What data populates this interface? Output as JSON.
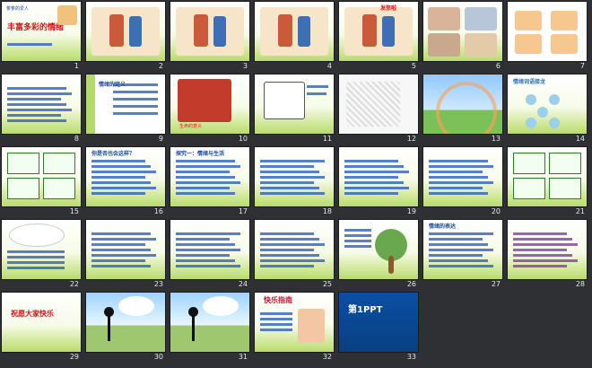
{
  "slides": [
    {
      "n": "1",
      "caption": "爹爹的爱人",
      "title": "丰富多彩的情绪",
      "kind": "title"
    },
    {
      "n": "2",
      "kind": "illustration"
    },
    {
      "n": "3",
      "kind": "illustration"
    },
    {
      "n": "4",
      "kind": "illustration"
    },
    {
      "n": "5",
      "kind": "illustration",
      "caption": "发怒啦"
    },
    {
      "n": "6",
      "kind": "photos"
    },
    {
      "n": "7",
      "kind": "faces"
    },
    {
      "n": "8",
      "kind": "text"
    },
    {
      "n": "9",
      "kind": "text-side",
      "caption": "情绪的定义"
    },
    {
      "n": "10",
      "kind": "photo",
      "caption": "生命的意义"
    },
    {
      "n": "11",
      "kind": "cartoon"
    },
    {
      "n": "12",
      "kind": "sketch"
    },
    {
      "n": "13",
      "kind": "rainbow"
    },
    {
      "n": "14",
      "kind": "faces-circle",
      "caption": "情绪词语接龙"
    },
    {
      "n": "15",
      "kind": "boxes"
    },
    {
      "n": "16",
      "kind": "text",
      "caption": "你是否也会这样？"
    },
    {
      "n": "17",
      "kind": "text",
      "caption": "探究一：情绪与生活"
    },
    {
      "n": "18",
      "kind": "text"
    },
    {
      "n": "19",
      "kind": "text"
    },
    {
      "n": "20",
      "kind": "text"
    },
    {
      "n": "21",
      "kind": "boxes"
    },
    {
      "n": "22",
      "kind": "cloud-text"
    },
    {
      "n": "23",
      "kind": "text"
    },
    {
      "n": "24",
      "kind": "text"
    },
    {
      "n": "25",
      "kind": "text"
    },
    {
      "n": "26",
      "kind": "tree"
    },
    {
      "n": "27",
      "kind": "text",
      "caption": "情绪的表达"
    },
    {
      "n": "28",
      "kind": "text-purple"
    },
    {
      "n": "29",
      "kind": "ending",
      "caption": "祝愿大家快乐"
    },
    {
      "n": "30",
      "kind": "stick-figure"
    },
    {
      "n": "31",
      "kind": "stick-figure"
    },
    {
      "n": "32",
      "kind": "kid",
      "caption": "快乐指南"
    },
    {
      "n": "33",
      "kind": "ppt",
      "caption": "第1PPT"
    }
  ],
  "colors": {
    "bg": "#2e3034",
    "accent_green": "#b5d96b",
    "text_blue": "#1a49a8",
    "text_red": "#d51515"
  }
}
